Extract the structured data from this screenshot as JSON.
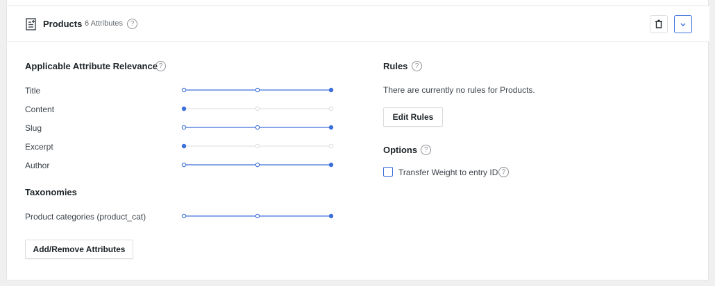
{
  "colors": {
    "accent": "#3d6fdb",
    "track_inactive": "#dcdcde"
  },
  "header": {
    "title": "Products",
    "attribute_count": "6 Attributes",
    "icon": "document-icon",
    "trash_icon": "trash-icon",
    "chevron_icon": "chevron-down-icon"
  },
  "relevance": {
    "title": "Applicable Attribute Relevance",
    "rows": [
      {
        "label": "Title",
        "level": 3
      },
      {
        "label": "Content",
        "level": 1
      },
      {
        "label": "Slug",
        "level": 3
      },
      {
        "label": "Excerpt",
        "level": 1
      },
      {
        "label": "Author",
        "level": 3
      }
    ]
  },
  "taxonomies": {
    "title": "Taxonomies",
    "rows": [
      {
        "label": "Product categories (product_cat)",
        "level": 3
      }
    ]
  },
  "add_remove_label": "Add/Remove Attributes",
  "rules": {
    "title": "Rules",
    "message": "There are currently no rules for Products.",
    "edit_label": "Edit Rules"
  },
  "options": {
    "title": "Options",
    "transfer_weight_label": "Transfer Weight to entry ID",
    "transfer_weight_checked": false
  },
  "help_glyph": "?"
}
